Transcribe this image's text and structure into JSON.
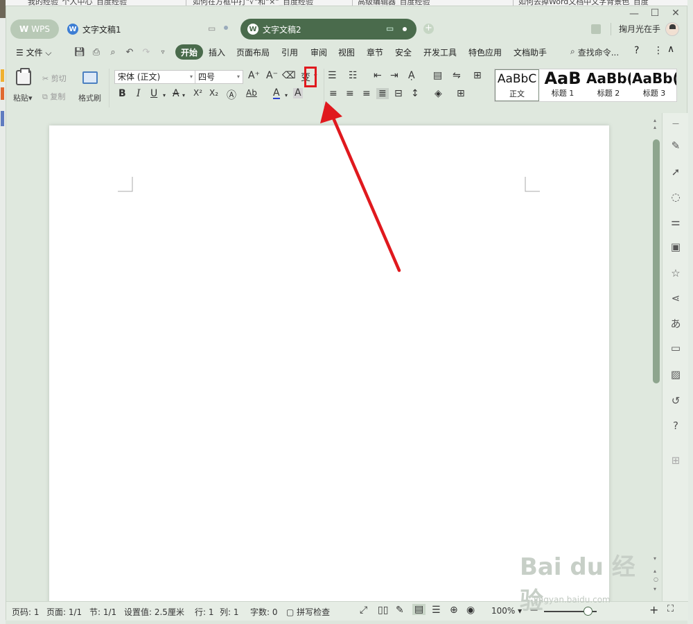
{
  "browser_tabs": [
    "我的经验_个人中心_百度经验",
    "如何在方框中打\"√\"和\"×\"_百度经验",
    "高级编辑器_百度经验",
    "如何去掉Word文档中文字背景色_百度"
  ],
  "titlebar": {
    "wps_label": "WPS",
    "doc_tab_1": "文字文稿1",
    "doc_tab_2": "文字文稿2",
    "user_name": "掬月光在手",
    "min_glyph": "—",
    "max_glyph": "☐",
    "close_glyph": "✕"
  },
  "menubar": {
    "file": "文件",
    "tabs": [
      "开始",
      "插入",
      "页面布局",
      "引用",
      "审阅",
      "视图",
      "章节",
      "安全",
      "开发工具",
      "特色应用",
      "文档助手"
    ],
    "search_label": "查找命令..."
  },
  "ribbon": {
    "paste": "粘贴",
    "cut": "剪切",
    "copy": "复制",
    "format_painter": "格式刷",
    "font_name": "宋体 (正文)",
    "font_size": "四号",
    "bold": "B",
    "italic": "I",
    "underline": "U",
    "strike": "A",
    "superscript": "X²",
    "subscript": "X₂",
    "grow_font": "A⁺",
    "shrink_font": "A⁻",
    "pinyin": "变",
    "font_color": "A",
    "highlight": "A",
    "char_shade": "A",
    "styles": [
      {
        "preview": "AaBbC",
        "name": "正文"
      },
      {
        "preview": "AaB",
        "name": "标题 1"
      },
      {
        "preview": "AaBb(",
        "name": "标题 2"
      },
      {
        "preview": "AaBb(",
        "name": "标题 3"
      }
    ]
  },
  "statusbar": {
    "page_num": "页码: 1",
    "pages": "页面: 1/1",
    "section": "节: 1/1",
    "setting": "设置值: 2.5厘米",
    "row": "行: 1",
    "col": "列: 1",
    "words": "字数: 0",
    "spell": "拼写检查",
    "zoom": "100%",
    "zoom_level": 0.83
  },
  "watermark": {
    "main": "Bai du 经验",
    "sub": "jingyan.baidu.com"
  },
  "colors": {
    "accent": "#4a6b4c",
    "annotation": "#e0191e",
    "blue_icon": "#3d7ed4"
  }
}
